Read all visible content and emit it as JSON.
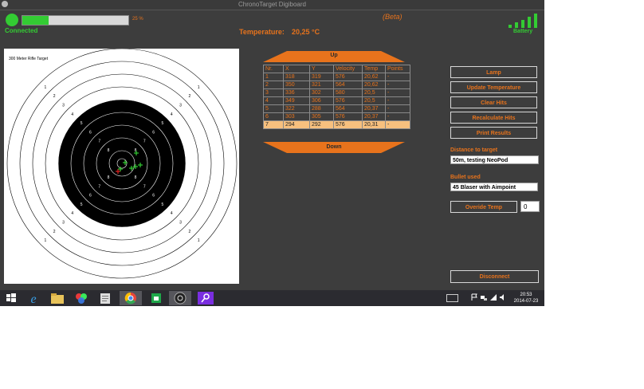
{
  "window": {
    "title": "ChronoTarget Digiboard"
  },
  "status": {
    "connected_label": "Connected",
    "progress_percent": 25,
    "progress_text": "25 %",
    "beta_label": "(Beta)",
    "battery_label": "Battery",
    "battery_bars": 5
  },
  "temperature": {
    "label": "Temperature:",
    "value": "20,25 °C"
  },
  "target": {
    "title": "300 Meter Rifle Target",
    "ring_numbers": [
      "1",
      "2",
      "3",
      "4",
      "5",
      "6",
      "7",
      "8",
      "9"
    ]
  },
  "hits": {
    "up_label": "Up",
    "down_label": "Down",
    "columns": [
      "Nr.",
      "X",
      "Y",
      "Velocity",
      "Temp",
      "Points"
    ],
    "rows": [
      [
        "1",
        "318",
        "319",
        "576",
        "20,62",
        "-"
      ],
      [
        "2",
        "350",
        "321",
        "564",
        "20,62",
        "-"
      ],
      [
        "3",
        "336",
        "302",
        "580",
        "20,5",
        "-"
      ],
      [
        "4",
        "349",
        "306",
        "576",
        "20,5",
        "-"
      ],
      [
        "5",
        "322",
        "288",
        "564",
        "20,37",
        "-"
      ],
      [
        "6",
        "303",
        "305",
        "576",
        "20,37",
        "-"
      ],
      [
        "7",
        "294",
        "292",
        "576",
        "20,31",
        "-"
      ]
    ],
    "selected_row": 6
  },
  "actions": {
    "lamp": "Lamp",
    "update_temperature": "Update Temperature",
    "clear_hits": "Clear Hits",
    "recalculate_hits": "Recalculate Hits",
    "print_results": "Print Results",
    "override_temp": "Overide Temp",
    "disconnect": "Disconnect"
  },
  "fields": {
    "distance_label": "Distance to target",
    "distance_value": "50m, testing NeoPod",
    "bullet_label": "Bullet used",
    "bullet_value": "45 Blaser with Aimpoint",
    "override_value": "0"
  },
  "taskbar": {
    "time": "20:53",
    "date": "2014-07-23",
    "icons": [
      "windows-start-icon",
      "internet-explorer-icon",
      "file-explorer-icon",
      "media-center-icon",
      "notepad-icon",
      "chrome-icon",
      "store-icon",
      "chronotarget-app-icon",
      "search-app-icon"
    ]
  },
  "colors": {
    "accent": "#e8731c",
    "connected": "#33cc33",
    "background": "#3d3d3d",
    "target_black": "#000000",
    "hit_green": "#33cc33",
    "hit_red": "#e02020",
    "selected_row": "#f7c07e"
  }
}
